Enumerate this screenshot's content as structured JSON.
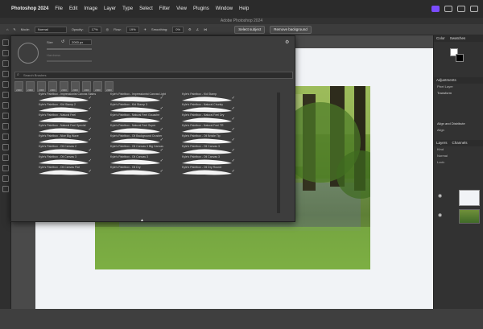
{
  "menubar": {
    "app_name": "Photoshop 2024",
    "items": [
      "File",
      "Edit",
      "Image",
      "Layer",
      "Type",
      "Select",
      "Filter",
      "View",
      "Plugins",
      "Window",
      "Help"
    ]
  },
  "window_title": "Adobe Photoshop 2024",
  "options_bar": {
    "mode_label": "Mode:",
    "mode_value": "Normal",
    "opacity_label": "Opacity:",
    "opacity_value": "17%",
    "flow_label": "Flow:",
    "flow_value": "19%",
    "smoothing_label": "Smoothing:",
    "smoothing_value": "0%",
    "select_subject": "Select subject",
    "remove_background": "Remove background"
  },
  "brush_panel": {
    "size_label": "Size",
    "size_value": "2000 px",
    "hardness_label": "Hardness",
    "search_placeholder": "Search Brushes",
    "presets": [
      "2000",
      "2000",
      "2000",
      "2000",
      "2000",
      "2000",
      "2000",
      "2000",
      "2000"
    ],
    "brushes": [
      "Kyle's Paintbox - Impressionist Canvas Stains",
      "Kyle's Paintbox - Impressionist Canvas Light",
      "Kyle's Paintbox - Kid Stamp",
      "Kyle's Paintbox - Kid Stamp 2",
      "Kyle's Paintbox - Kid Stamp 3",
      "Kyle's Paintbox - Natural Chunky",
      "Kyle's Paintbox - Natural Feel",
      "Kyle's Paintbox - Natural Feel Gouache",
      "Kyle's Paintbox - Natural Feel Dry",
      "Kyle's Paintbox - Natural Feel Special",
      "Kyle's Paintbox - Natural Feel Super",
      "Kyle's Paintbox - Natural Feel TR",
      "Kyle's Paintbox - Nice Big Wave",
      "Kyle's Paintbox - Oil Background Crusher",
      "Kyle's Paintbox - Oil Bristle Tip",
      "Kyle's Paintbox - Oil Canvas 2",
      "Kyle's Paintbox - Oil Canvas 3 Big Canvas",
      "Kyle's Paintbox - Oil Canvas 3",
      "Kyle's Paintbox - Oil Canvas 3",
      "Kyle's Paintbox - Oil Canvas 3",
      "Kyle's Paintbox - Oil Canvas 3",
      "Kyle's Paintbox - Oil Canvas Flat",
      "Kyle's Paintbox - Oil Dry",
      "Kyle's Paintbox - Oil Dry Round"
    ]
  },
  "right_panel": {
    "color_tab": "Color",
    "swatches_tab": "Swatches",
    "adjustments_tab": "Adjustments",
    "pixel_layer": "Pixel Layer",
    "transform": "Transform",
    "align": "Align and Distribute",
    "align_sub": "Align",
    "layers_tab": "Layers",
    "channels_tab": "Channels",
    "kind_filter": "Kind",
    "blend_mode": "Normal",
    "lock_label": "Lock:"
  }
}
